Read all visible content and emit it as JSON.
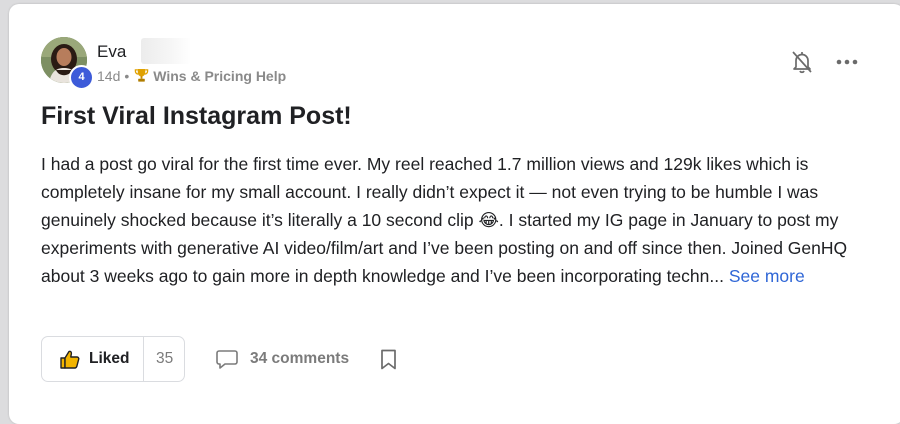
{
  "post": {
    "author": {
      "name": "Eva",
      "level": "4",
      "avatar_icon": "avatar-photo"
    },
    "age": "14d",
    "separator": "•",
    "category": "Wins & Pricing Help",
    "category_icon": "trophy-icon",
    "title": "First Viral Instagram Post!",
    "body": "I had a post go viral for the first time ever. My reel reached 1.7 million views and 129k likes which is completely insane for my small account. I really didn’t expect it — not even trying to be humble I was genuinely shocked because it’s literally a 10 second clip 😂. I started my IG page in January to post my experiments with generative AI video/film/art and I’ve been posting on and off since then. Joined GenHQ about 3 weeks ago to gain more in depth knowledge and I’ve been incorporating techn...",
    "see_more": "See more"
  },
  "actions": {
    "like_label": "Liked",
    "like_count": "35",
    "comments_label": "34 comments"
  },
  "colors": {
    "accent_blue": "#2f66d6",
    "level_badge": "#3d5bd9",
    "text": "#202124",
    "muted": "#7b7b7b"
  }
}
